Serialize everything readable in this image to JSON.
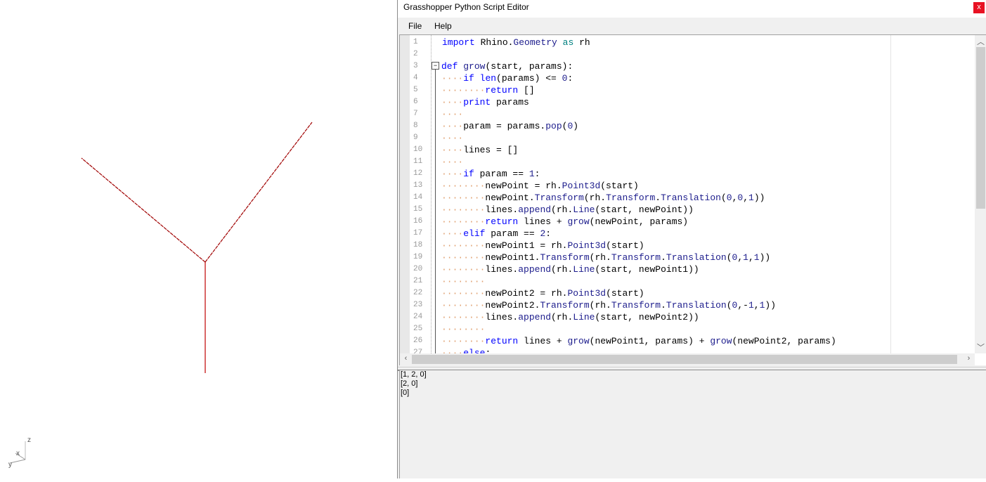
{
  "viewport": {
    "axes": {
      "z": "z",
      "x": "x",
      "y": "y"
    },
    "line_color": "#c00000"
  },
  "editor": {
    "title": "Grasshopper Python Script Editor",
    "close_label": "x",
    "menu": {
      "file": "File",
      "help": "Help"
    },
    "code_lines": [
      "import Rhino.Geometry as rh",
      "",
      "def grow(start, params):",
      "····if len(params) <= 0:",
      "········return []",
      "····print params",
      "····",
      "····param = params.pop(0)",
      "····",
      "····lines = []",
      "····",
      "····if param == 1:",
      "········newPoint = rh.Point3d(start)",
      "········newPoint.Transform(rh.Transform.Translation(0,0,1))",
      "········lines.append(rh.Line(start, newPoint))",
      "········return lines + grow(newPoint, params)",
      "····elif param == 2:",
      "········newPoint1 = rh.Point3d(start)",
      "········newPoint1.Transform(rh.Transform.Translation(0,1,1))",
      "········lines.append(rh.Line(start, newPoint1))",
      "········",
      "········newPoint2 = rh.Point3d(start)",
      "········newPoint2.Transform(rh.Transform.Translation(0,-1,1))",
      "········lines.append(rh.Line(start, newPoint2))",
      "········",
      "········return lines + grow(newPoint1, params) + grow(newPoint2, params)",
      "····else:"
    ],
    "output_lines": [
      "[1, 2, 0]",
      "[2, 0]",
      "[0]"
    ]
  }
}
